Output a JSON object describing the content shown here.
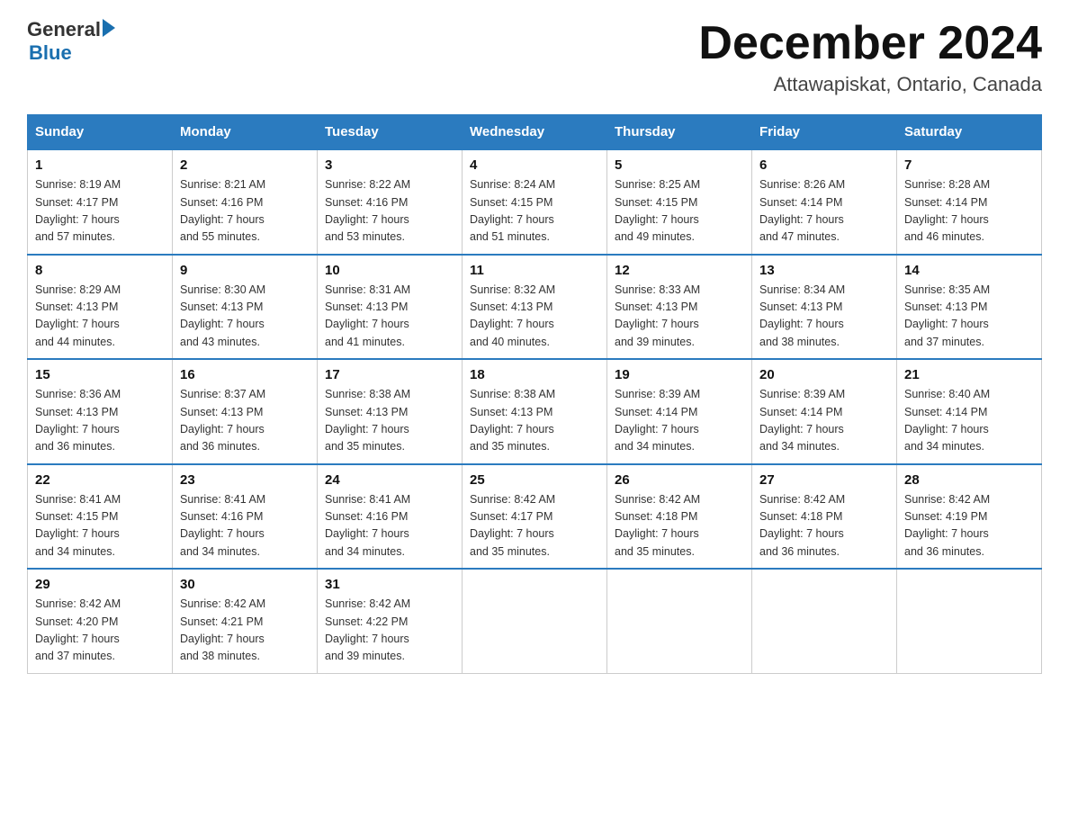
{
  "header": {
    "logo_general": "General",
    "logo_blue": "Blue",
    "month": "December 2024",
    "location": "Attawapiskat, Ontario, Canada"
  },
  "days_of_week": [
    "Sunday",
    "Monday",
    "Tuesday",
    "Wednesday",
    "Thursday",
    "Friday",
    "Saturday"
  ],
  "weeks": [
    [
      {
        "day": "1",
        "sunrise": "8:19 AM",
        "sunset": "4:17 PM",
        "daylight": "7 hours and 57 minutes."
      },
      {
        "day": "2",
        "sunrise": "8:21 AM",
        "sunset": "4:16 PM",
        "daylight": "7 hours and 55 minutes."
      },
      {
        "day": "3",
        "sunrise": "8:22 AM",
        "sunset": "4:16 PM",
        "daylight": "7 hours and 53 minutes."
      },
      {
        "day": "4",
        "sunrise": "8:24 AM",
        "sunset": "4:15 PM",
        "daylight": "7 hours and 51 minutes."
      },
      {
        "day": "5",
        "sunrise": "8:25 AM",
        "sunset": "4:15 PM",
        "daylight": "7 hours and 49 minutes."
      },
      {
        "day": "6",
        "sunrise": "8:26 AM",
        "sunset": "4:14 PM",
        "daylight": "7 hours and 47 minutes."
      },
      {
        "day": "7",
        "sunrise": "8:28 AM",
        "sunset": "4:14 PM",
        "daylight": "7 hours and 46 minutes."
      }
    ],
    [
      {
        "day": "8",
        "sunrise": "8:29 AM",
        "sunset": "4:13 PM",
        "daylight": "7 hours and 44 minutes."
      },
      {
        "day": "9",
        "sunrise": "8:30 AM",
        "sunset": "4:13 PM",
        "daylight": "7 hours and 43 minutes."
      },
      {
        "day": "10",
        "sunrise": "8:31 AM",
        "sunset": "4:13 PM",
        "daylight": "7 hours and 41 minutes."
      },
      {
        "day": "11",
        "sunrise": "8:32 AM",
        "sunset": "4:13 PM",
        "daylight": "7 hours and 40 minutes."
      },
      {
        "day": "12",
        "sunrise": "8:33 AM",
        "sunset": "4:13 PM",
        "daylight": "7 hours and 39 minutes."
      },
      {
        "day": "13",
        "sunrise": "8:34 AM",
        "sunset": "4:13 PM",
        "daylight": "7 hours and 38 minutes."
      },
      {
        "day": "14",
        "sunrise": "8:35 AM",
        "sunset": "4:13 PM",
        "daylight": "7 hours and 37 minutes."
      }
    ],
    [
      {
        "day": "15",
        "sunrise": "8:36 AM",
        "sunset": "4:13 PM",
        "daylight": "7 hours and 36 minutes."
      },
      {
        "day": "16",
        "sunrise": "8:37 AM",
        "sunset": "4:13 PM",
        "daylight": "7 hours and 36 minutes."
      },
      {
        "day": "17",
        "sunrise": "8:38 AM",
        "sunset": "4:13 PM",
        "daylight": "7 hours and 35 minutes."
      },
      {
        "day": "18",
        "sunrise": "8:38 AM",
        "sunset": "4:13 PM",
        "daylight": "7 hours and 35 minutes."
      },
      {
        "day": "19",
        "sunrise": "8:39 AM",
        "sunset": "4:14 PM",
        "daylight": "7 hours and 34 minutes."
      },
      {
        "day": "20",
        "sunrise": "8:39 AM",
        "sunset": "4:14 PM",
        "daylight": "7 hours and 34 minutes."
      },
      {
        "day": "21",
        "sunrise": "8:40 AM",
        "sunset": "4:14 PM",
        "daylight": "7 hours and 34 minutes."
      }
    ],
    [
      {
        "day": "22",
        "sunrise": "8:41 AM",
        "sunset": "4:15 PM",
        "daylight": "7 hours and 34 minutes."
      },
      {
        "day": "23",
        "sunrise": "8:41 AM",
        "sunset": "4:16 PM",
        "daylight": "7 hours and 34 minutes."
      },
      {
        "day": "24",
        "sunrise": "8:41 AM",
        "sunset": "4:16 PM",
        "daylight": "7 hours and 34 minutes."
      },
      {
        "day": "25",
        "sunrise": "8:42 AM",
        "sunset": "4:17 PM",
        "daylight": "7 hours and 35 minutes."
      },
      {
        "day": "26",
        "sunrise": "8:42 AM",
        "sunset": "4:18 PM",
        "daylight": "7 hours and 35 minutes."
      },
      {
        "day": "27",
        "sunrise": "8:42 AM",
        "sunset": "4:18 PM",
        "daylight": "7 hours and 36 minutes."
      },
      {
        "day": "28",
        "sunrise": "8:42 AM",
        "sunset": "4:19 PM",
        "daylight": "7 hours and 36 minutes."
      }
    ],
    [
      {
        "day": "29",
        "sunrise": "8:42 AM",
        "sunset": "4:20 PM",
        "daylight": "7 hours and 37 minutes."
      },
      {
        "day": "30",
        "sunrise": "8:42 AM",
        "sunset": "4:21 PM",
        "daylight": "7 hours and 38 minutes."
      },
      {
        "day": "31",
        "sunrise": "8:42 AM",
        "sunset": "4:22 PM",
        "daylight": "7 hours and 39 minutes."
      },
      null,
      null,
      null,
      null
    ]
  ],
  "sunrise_label": "Sunrise: ",
  "sunset_label": "Sunset: ",
  "daylight_label": "Daylight: "
}
